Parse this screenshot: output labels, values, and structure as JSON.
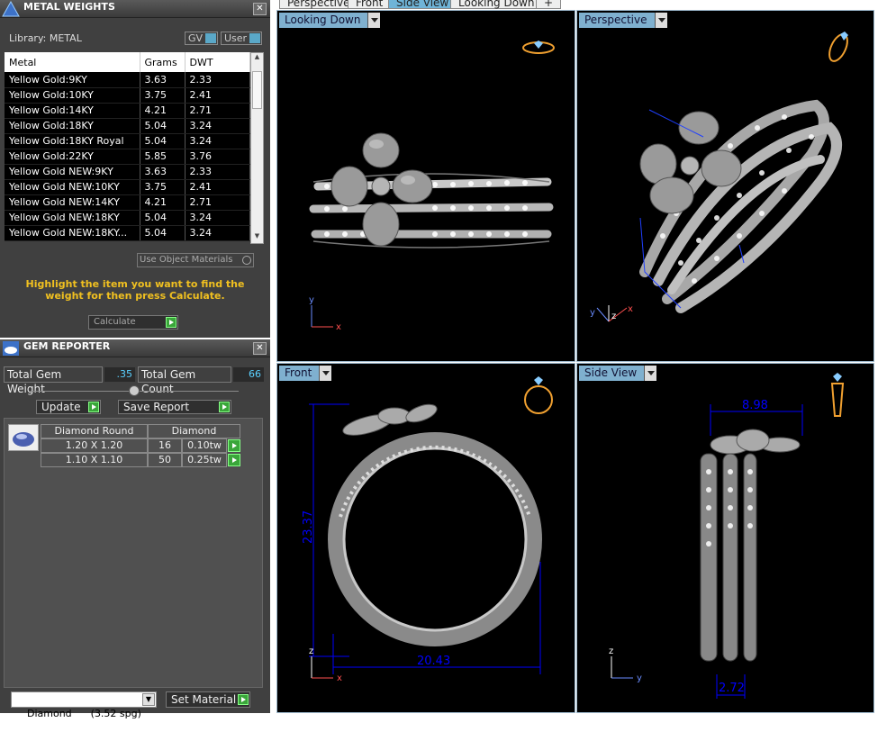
{
  "metal_weights": {
    "title": "METAL WEIGHTS",
    "library_label": "Library: METAL",
    "gv_label": "GV",
    "user_label": "User",
    "columns": [
      "Metal",
      "Grams",
      "DWT"
    ],
    "rows": [
      [
        "Yellow Gold:9KY",
        "3.63",
        "2.33"
      ],
      [
        "Yellow Gold:10KY",
        "3.75",
        "2.41"
      ],
      [
        "Yellow Gold:14KY",
        "4.21",
        "2.71"
      ],
      [
        "Yellow Gold:18KY",
        "5.04",
        "3.24"
      ],
      [
        "Yellow Gold:18KY Royal",
        "5.04",
        "3.24"
      ],
      [
        "Yellow Gold:22KY",
        "5.85",
        "3.76"
      ],
      [
        "Yellow Gold NEW:9KY",
        "3.63",
        "2.33"
      ],
      [
        "Yellow Gold NEW:10KY",
        "3.75",
        "2.41"
      ],
      [
        "Yellow Gold NEW:14KY",
        "4.21",
        "2.71"
      ],
      [
        "Yellow Gold NEW:18KY",
        "5.04",
        "3.24"
      ],
      [
        "Yellow Gold NEW:18KY...",
        "5.04",
        "3.24"
      ]
    ],
    "use_object_materials": "Use Object Materials",
    "instruction": "Highlight the item you want to find the weight for then press Calculate.",
    "calculate_label": "Calculate"
  },
  "gem_reporter": {
    "title": "GEM REPORTER",
    "total_weight_label": "Total Gem Weight",
    "total_weight_value": ".35",
    "total_count_label": "Total Gem Count",
    "total_count_value": "66",
    "update_label": "Update",
    "save_report_label": "Save Report",
    "gem_columns": [
      "Diamond Round",
      "Diamond"
    ],
    "gem_rows": [
      [
        "1.20 X 1.20",
        "16",
        "0.10tw"
      ],
      [
        "1.10 X 1.10",
        "50",
        "0.25tw"
      ]
    ],
    "material_select": "Diamond      (3.52 spg)",
    "set_material_label": "Set Material"
  },
  "top_tabs": [
    "Perspective",
    "Front",
    "Side View",
    "Looking Down"
  ],
  "viewports": {
    "looking_down": "Looking Down",
    "perspective": "Perspective",
    "front": "Front",
    "side_view": "Side View"
  },
  "dimensions": {
    "front_height": "23.37",
    "front_width": "20.43",
    "side_top": "8.98",
    "side_bottom": "2.72"
  },
  "axes": {
    "x": "x",
    "y": "y",
    "z": "z"
  },
  "colors": {
    "accent": "#7fb0cf",
    "instruction": "#f0c020",
    "dimension": "#0000ff"
  }
}
